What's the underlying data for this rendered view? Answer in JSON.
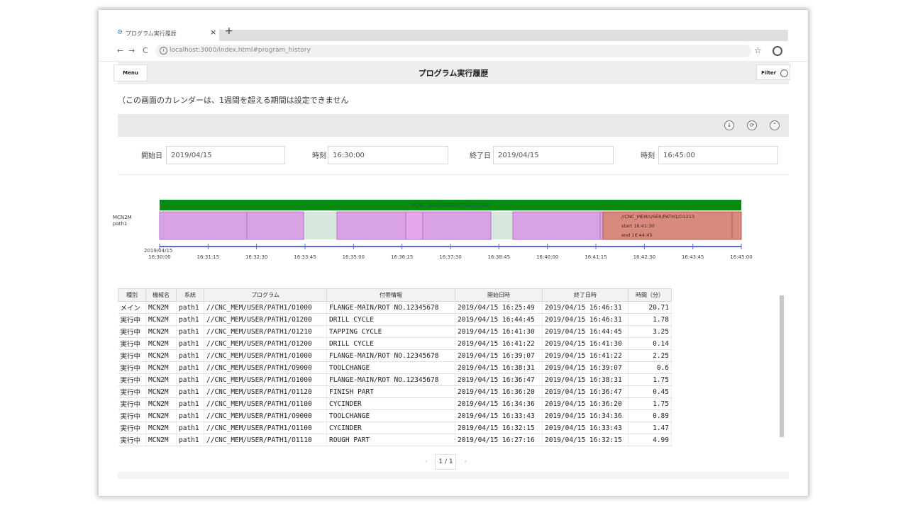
{
  "browser": {
    "tab_title": "プログラム実行履歴",
    "tab_close": "×",
    "new_tab": "+",
    "back": "←",
    "forward": "→",
    "reload": "C",
    "url": "localhost:3000/index.html#program_history"
  },
  "header": {
    "menu_label": "Menu",
    "title": "プログラム実行履歴",
    "filter_label": "Filter"
  },
  "notice": "（この画面のカレンダーは、1週間を超える期間は設定できません",
  "filters": {
    "start_date_label": "開始日",
    "start_date_value": "2019/04/15",
    "start_time_label": "時刻",
    "start_time_value": "16:30:00",
    "end_date_label": "終了日",
    "end_date_value": "2019/04/15",
    "end_time_label": "時刻",
    "end_time_value": "16:45:00"
  },
  "timeline": {
    "machine_label_1": "MCN2M",
    "machine_label_2": "path1",
    "main_bar_label": "//CNC_MEM/USER/PATH1/O1000",
    "tooltip_line_1": "//CNC_MEM/USER/PATH1/O1213",
    "tooltip_line_2": "start 16:41:30",
    "tooltip_line_3": "end 16:44:45",
    "date_tick": "2019/04/15",
    "ticks": [
      "16:30:00",
      "16:31:15",
      "16:32:30",
      "16:33:45",
      "16:35:00",
      "16:36:15",
      "16:37:30",
      "16:38:45",
      "16:40:00",
      "16:41:15",
      "16:42:30",
      "16:43:45",
      "16:45:00"
    ],
    "colors": {
      "main": "#0a8a10",
      "run": "#d8a2e4",
      "idle": "#d6e8dd",
      "selected": "#d98a7e",
      "axis": "#5b66e8"
    }
  },
  "table": {
    "headers": [
      "種別",
      "機械名",
      "系統",
      "プログラム",
      "付帯情報",
      "開始日時",
      "終了日時",
      "時間（分）"
    ],
    "rows": [
      [
        "メイン",
        "MCN2M",
        "path1",
        "//CNC_MEM/USER/PATH1/O1000",
        "FLANGE-MAIN/ROT NO.12345678",
        "2019/04/15 16:25:49",
        "2019/04/15 16:46:31",
        "20.71"
      ],
      [
        "実行中",
        "MCN2M",
        "path1",
        "//CNC_MEM/USER/PATH1/O1200",
        "DRILL CYCLE",
        "2019/04/15 16:44:45",
        "2019/04/15 16:46:31",
        "1.78"
      ],
      [
        "実行中",
        "MCN2M",
        "path1",
        "//CNC_MEM/USER/PATH1/O1210",
        "TAPPING CYCLE",
        "2019/04/15 16:41:30",
        "2019/04/15 16:44:45",
        "3.25"
      ],
      [
        "実行中",
        "MCN2M",
        "path1",
        "//CNC_MEM/USER/PATH1/O1200",
        "DRILL CYCLE",
        "2019/04/15 16:41:22",
        "2019/04/15 16:41:30",
        "0.14"
      ],
      [
        "実行中",
        "MCN2M",
        "path1",
        "//CNC_MEM/USER/PATH1/O1000",
        "FLANGE-MAIN/ROT NO.12345678",
        "2019/04/15 16:39:07",
        "2019/04/15 16:41:22",
        "2.25"
      ],
      [
        "実行中",
        "MCN2M",
        "path1",
        "//CNC_MEM/USER/PATH1/O9000",
        "TOOLCHANGE",
        "2019/04/15 16:38:31",
        "2019/04/15 16:39:07",
        "0.6"
      ],
      [
        "実行中",
        "MCN2M",
        "path1",
        "//CNC_MEM/USER/PATH1/O1000",
        "FLANGE-MAIN/ROT NO.12345678",
        "2019/04/15 16:36:47",
        "2019/04/15 16:38:31",
        "1.75"
      ],
      [
        "実行中",
        "MCN2M",
        "path1",
        "//CNC_MEM/USER/PATH1/O1120",
        "FINISH PART",
        "2019/04/15 16:36:20",
        "2019/04/15 16:36:47",
        "0.45"
      ],
      [
        "実行中",
        "MCN2M",
        "path1",
        "//CNC_MEM/USER/PATH1/O1100",
        "CYCINDER",
        "2019/04/15 16:34:36",
        "2019/04/15 16:36:20",
        "1.75"
      ],
      [
        "実行中",
        "MCN2M",
        "path1",
        "//CNC_MEM/USER/PATH1/O9000",
        "TOOLCHANGE",
        "2019/04/15 16:33:43",
        "2019/04/15 16:34:36",
        "0.89"
      ],
      [
        "実行中",
        "MCN2M",
        "path1",
        "//CNC_MEM/USER/PATH1/O1100",
        "CYCINDER",
        "2019/04/15 16:32:15",
        "2019/04/15 16:33:43",
        "1.47"
      ],
      [
        "実行中",
        "MCN2M",
        "path1",
        "//CNC_MEM/USER/PATH1/O1110",
        "ROUGH PART",
        "2019/04/15 16:27:16",
        "2019/04/15 16:32:15",
        "4.99"
      ]
    ]
  },
  "pager": {
    "prev": "‹",
    "page": "1 / 1",
    "next": "›"
  }
}
